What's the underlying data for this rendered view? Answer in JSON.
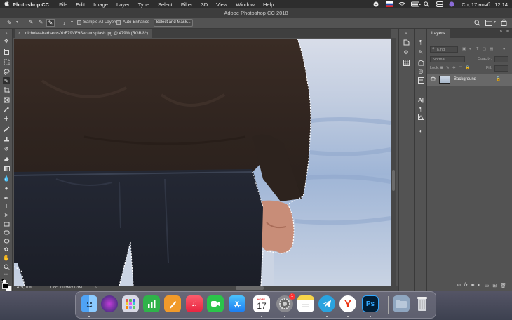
{
  "menubar": {
    "apple": "",
    "app_name": "Photoshop CC",
    "items": [
      "File",
      "Edit",
      "Image",
      "Layer",
      "Type",
      "Select",
      "Filter",
      "3D",
      "View",
      "Window",
      "Help"
    ],
    "clock": "Ср, 17 нояб.  12:14"
  },
  "window": {
    "title": "Adobe Photoshop CC 2018"
  },
  "options": {
    "sample_all_layers": "Sample All Layers",
    "auto_enhance": "Auto-Enhance",
    "select_and_mask": "Select and Mask...",
    "brush_size": "1"
  },
  "document": {
    "tab_title": "nicholas-barbaros-YoF79VE9Sec-unsplash.jpg @ 479% (RGB/8*)",
    "zoom": "479,07%",
    "doc_info": "Doc: 7,03M/7,03M"
  },
  "layers_panel": {
    "tab": "Layers",
    "kind": "Kind",
    "blend_mode": "Normal",
    "opacity_label": "Opacity:",
    "lock_label": "Lock:",
    "fill_label": "Fill:",
    "layer_name": "Background"
  },
  "dock": {
    "calendar_month": "НОЯБ.",
    "calendar_day": "17",
    "settings_badge": "1",
    "ps_label": "Ps"
  },
  "colors": {
    "menubar": "#2d2d2d",
    "panel": "#535353",
    "photoshop_blue": "#31a8ff"
  }
}
